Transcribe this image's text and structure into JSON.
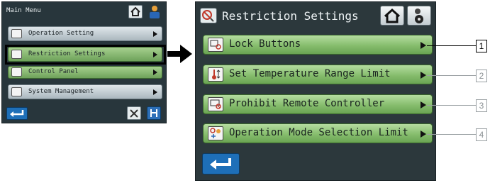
{
  "main_menu": {
    "title": "Main Menu",
    "items": [
      {
        "label": "Operation Setting",
        "icon": "operation-setting-icon"
      },
      {
        "label": "Restriction Settings",
        "icon": "restriction-settings-icon"
      },
      {
        "label": "Control Panel",
        "icon": "control-panel-icon"
      },
      {
        "label": "System Management",
        "icon": "system-management-icon"
      }
    ]
  },
  "restriction": {
    "title": "Restriction Settings",
    "items": [
      {
        "label": "Lock Buttons",
        "icon": "lock-buttons-icon"
      },
      {
        "label": "Set Temperature Range Limit",
        "icon": "thermometer-icon"
      },
      {
        "label": "Prohibit Remote Controller",
        "icon": "prohibit-remote-icon"
      },
      {
        "label": "Operation Mode Selection Limit",
        "icon": "mode-limit-icon"
      }
    ]
  },
  "callouts": [
    "1",
    "2",
    "3",
    "4"
  ],
  "colors": {
    "panel_bg": "#2c383c",
    "button_green": "#86bd6d",
    "back_blue": "#1e6fb8"
  }
}
